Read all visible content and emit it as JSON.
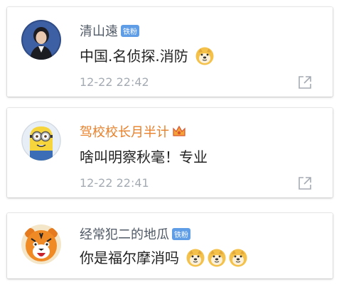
{
  "comments": [
    {
      "username": "清山遠",
      "badge": "铁粉",
      "text": "中国.名侦探.消防",
      "time": "12-22 22:42",
      "emoji_count": 1,
      "avatar_icon": "person-portrait-icon"
    },
    {
      "username": "驾校校长月半计",
      "badge_icon": "crown-icon",
      "text": "啥叫明察秋毫！专业",
      "time": "12-22 22:41",
      "emoji_count": 0,
      "avatar_icon": "minion-icon"
    },
    {
      "username": "经常犯二的地瓜",
      "badge": "铁粉",
      "text": "你是福尔摩消吗",
      "emoji_count": 3,
      "avatar_icon": "tiger-icon"
    }
  ],
  "colors": {
    "name": "#505a66",
    "vip_name": "#e8802a",
    "badge_bg": "#5f9ee6",
    "time": "#a5abb3",
    "text": "#222222"
  }
}
